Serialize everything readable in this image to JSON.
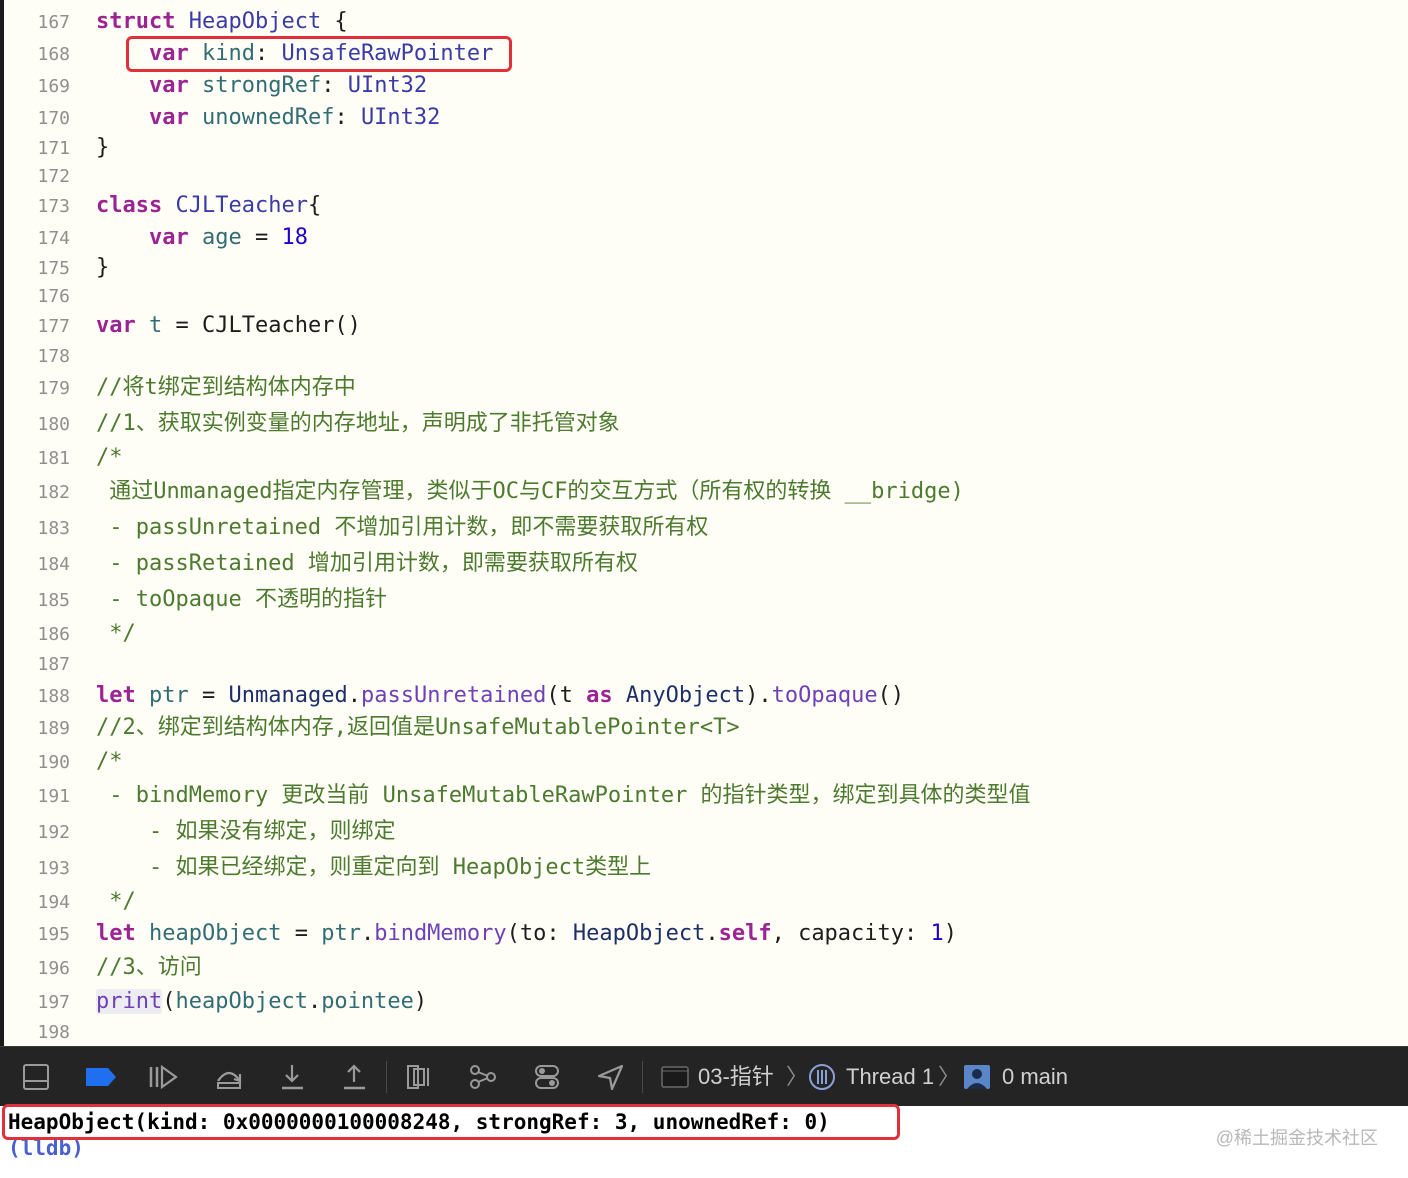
{
  "editor": {
    "line_numbers": [
      "167",
      "168",
      "169",
      "170",
      "171",
      "172",
      "173",
      "174",
      "175",
      "176",
      "177",
      "178",
      "179",
      "180",
      "181",
      "182",
      "183",
      "184",
      "185",
      "186",
      "187",
      "188",
      "189",
      "190",
      "191",
      "192",
      "193",
      "194",
      "195",
      "196",
      "197",
      "198"
    ],
    "lines": [
      [
        {
          "t": "struct",
          "c": "kw"
        },
        {
          "t": " "
        },
        {
          "t": "HeapObject",
          "c": "ty"
        },
        {
          "t": " {"
        }
      ],
      [
        {
          "t": "    "
        },
        {
          "t": "var",
          "c": "kw"
        },
        {
          "t": " "
        },
        {
          "t": "kind",
          "c": "id"
        },
        {
          "t": ": "
        },
        {
          "t": "UnsafeRawPointer",
          "c": "ty"
        }
      ],
      [
        {
          "t": "    "
        },
        {
          "t": "var",
          "c": "kw"
        },
        {
          "t": " "
        },
        {
          "t": "strongRef",
          "c": "id"
        },
        {
          "t": ": "
        },
        {
          "t": "UInt32",
          "c": "ty"
        }
      ],
      [
        {
          "t": "    "
        },
        {
          "t": "var",
          "c": "kw"
        },
        {
          "t": " "
        },
        {
          "t": "unownedRef",
          "c": "id"
        },
        {
          "t": ": "
        },
        {
          "t": "UInt32",
          "c": "ty"
        }
      ],
      [
        {
          "t": "}"
        }
      ],
      [],
      [
        {
          "t": "class",
          "c": "kw"
        },
        {
          "t": " "
        },
        {
          "t": "CJLTeacher",
          "c": "ty"
        },
        {
          "t": "{"
        }
      ],
      [
        {
          "t": "    "
        },
        {
          "t": "var",
          "c": "kw"
        },
        {
          "t": " "
        },
        {
          "t": "age",
          "c": "id"
        },
        {
          "t": " = "
        },
        {
          "t": "18",
          "c": "num"
        }
      ],
      [
        {
          "t": "}"
        }
      ],
      [],
      [
        {
          "t": "var",
          "c": "kw"
        },
        {
          "t": " "
        },
        {
          "t": "t",
          "c": "id"
        },
        {
          "t": " = CJLTeacher()"
        }
      ],
      [],
      [
        {
          "t": "//将t绑定到结构体内存中",
          "c": "cm"
        }
      ],
      [
        {
          "t": "//1、获取实例变量的内存地址，声明成了非托管对象",
          "c": "cm"
        }
      ],
      [
        {
          "t": "/*",
          "c": "cm"
        }
      ],
      [
        {
          "t": " 通过Unmanaged指定内存管理，类似于OC与CF的交互方式（所有权的转换 __bridge)",
          "c": "cm"
        }
      ],
      [
        {
          "t": " - passUnretained 不增加引用计数，即不需要获取所有权",
          "c": "cm"
        }
      ],
      [
        {
          "t": " - passRetained 增加引用计数，即需要获取所有权",
          "c": "cm"
        }
      ],
      [
        {
          "t": " - toOpaque 不透明的指针",
          "c": "cm"
        }
      ],
      [
        {
          "t": " */",
          "c": "cm"
        }
      ],
      [],
      [
        {
          "t": "let",
          "c": "kw"
        },
        {
          "t": " "
        },
        {
          "t": "ptr",
          "c": "id"
        },
        {
          "t": " = "
        },
        {
          "t": "Unmanaged",
          "c": "tyn"
        },
        {
          "t": "."
        },
        {
          "t": "passUnretained",
          "c": "mth"
        },
        {
          "t": "(t "
        },
        {
          "t": "as",
          "c": "kw"
        },
        {
          "t": " "
        },
        {
          "t": "AnyObject",
          "c": "tyn"
        },
        {
          "t": ")."
        },
        {
          "t": "toOpaque",
          "c": "mth"
        },
        {
          "t": "()"
        }
      ],
      [
        {
          "t": "//2、绑定到结构体内存,返回值是UnsafeMutablePointer<T>",
          "c": "cm"
        }
      ],
      [
        {
          "t": "/*",
          "c": "cm"
        }
      ],
      [
        {
          "t": " - bindMemory 更改当前 UnsafeMutableRawPointer 的指针类型，绑定到具体的类型值",
          "c": "cm"
        }
      ],
      [
        {
          "t": "    - 如果没有绑定，则绑定",
          "c": "cm"
        }
      ],
      [
        {
          "t": "    - 如果已经绑定，则重定向到 HeapObject类型上",
          "c": "cm"
        }
      ],
      [
        {
          "t": " */",
          "c": "cm"
        }
      ],
      [
        {
          "t": "let",
          "c": "kw"
        },
        {
          "t": " "
        },
        {
          "t": "heapObject",
          "c": "id"
        },
        {
          "t": " = "
        },
        {
          "t": "ptr",
          "c": "id"
        },
        {
          "t": "."
        },
        {
          "t": "bindMemory",
          "c": "mth"
        },
        {
          "t": "(to: "
        },
        {
          "t": "HeapObject",
          "c": "tyn"
        },
        {
          "t": "."
        },
        {
          "t": "self",
          "c": "kw"
        },
        {
          "t": ", capacity: "
        },
        {
          "t": "1",
          "c": "num"
        },
        {
          "t": ")"
        }
      ],
      [
        {
          "t": "//3、访问",
          "c": "cm"
        }
      ],
      [
        {
          "t": "print",
          "c": "mth hl-print"
        },
        {
          "t": "("
        },
        {
          "t": "heapObject",
          "c": "id"
        },
        {
          "t": "."
        },
        {
          "t": "pointee",
          "c": "id"
        },
        {
          "t": ")"
        }
      ],
      []
    ]
  },
  "debug_bar": {
    "icons": [
      "console-toggle-icon",
      "breakpoints-active-icon",
      "continue-icon",
      "step-over-icon",
      "step-into-icon",
      "step-out-icon",
      "view-debugger-icon",
      "memory-graph-icon",
      "environment-overrides-icon",
      "simulate-location-icon"
    ],
    "scheme": "03-指针",
    "thread": "Thread 1",
    "frame": "0 main"
  },
  "console": {
    "output": "HeapObject(kind: 0x0000000100008248, strongRef: 3, unownedRef: 0)",
    "prompt": "(lldb)"
  },
  "watermark": "@稀土掘金技术社区",
  "colors": {
    "highlight_border": "#e0303b",
    "keyword": "#9b2393",
    "comment": "#4c7a2e",
    "editor_bg": "#fffef6",
    "debug_bar_bg": "#242424",
    "breakpoint_blue": "#1f6fee"
  }
}
